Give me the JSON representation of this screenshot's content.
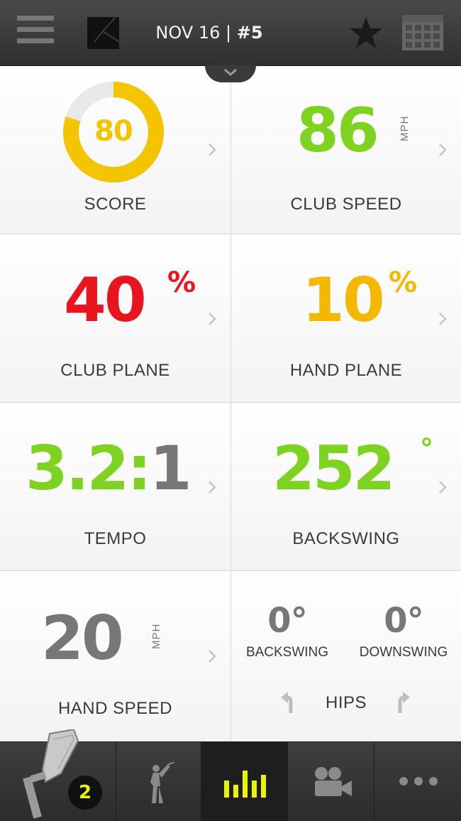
{
  "header": {
    "date": "NOV 16 |",
    "session": "#5"
  },
  "tiles": {
    "score": {
      "value": "80",
      "label": "SCORE",
      "progress": 0.8,
      "color": "#f5c400"
    },
    "club_speed": {
      "value": "86",
      "unit": "MPH",
      "label": "CLUB SPEED",
      "color": "#7ed321"
    },
    "club_plane": {
      "value": "40",
      "symbol": "%",
      "label": "CLUB PLANE",
      "color": "#e8141e"
    },
    "hand_plane": {
      "value": "10",
      "symbol": "%",
      "label": "HAND PLANE",
      "color": "#f5b800"
    },
    "tempo": {
      "value_main": "3.2:",
      "value_end": "1",
      "label": "TEMPO",
      "color": "#7ed321"
    },
    "backswing": {
      "value": "252",
      "symbol": "°",
      "label": "BACKSWING",
      "color": "#7ed321"
    },
    "hand_speed": {
      "value": "20",
      "unit": "MPH",
      "label": "HAND SPEED",
      "color": "#777777"
    },
    "hips": {
      "label": "HIPS",
      "backswing_value": "0°",
      "backswing_label": "BACKSWING",
      "downswing_value": "0°",
      "downswing_label": "DOWNSWING"
    }
  },
  "tabbar": {
    "club_badge": "2",
    "icons": [
      "golf-club-icon",
      "golfer-icon",
      "bar-chart-icon",
      "video-camera-icon",
      "more-icon"
    ],
    "active_index": 2,
    "accent": "#e8f400"
  }
}
